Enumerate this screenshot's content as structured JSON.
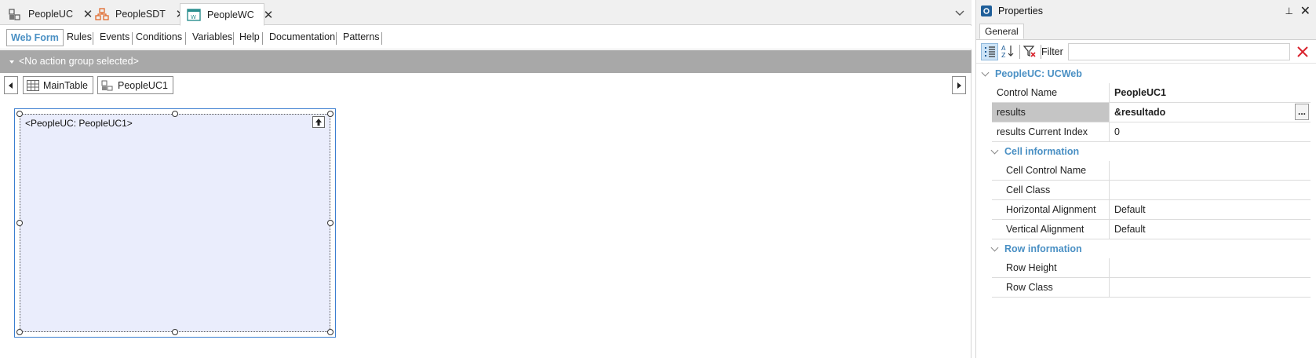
{
  "editor": {
    "doc_tabs": [
      {
        "label": "PeopleUC",
        "icon": "user-control-icon",
        "close": "✕"
      },
      {
        "label": "PeopleSDT",
        "icon": "sdt-icon",
        "close": "✕"
      },
      {
        "label": "PeopleWC",
        "icon": "web-component-icon",
        "close": "✕",
        "active": true
      }
    ],
    "section_tabs": [
      "Web Form",
      "Rules",
      "Events",
      "Conditions",
      "Variables",
      "Help",
      "Documentation",
      "Patterns"
    ],
    "active_section": "Web Form",
    "action_group": "<No action group selected>",
    "breadcrumb": [
      "MainTable",
      "PeopleUC1"
    ],
    "control_label": "<PeopleUC: PeopleUC1>"
  },
  "properties": {
    "title": "Properties",
    "pin": "⊥",
    "close": "✕",
    "tab": "General",
    "filter_label": "Filter",
    "filter_value": "",
    "category_main": "PeopleUC: UCWeb",
    "rows_main": [
      {
        "name": "Control Name",
        "value": "PeopleUC1",
        "bold": true
      },
      {
        "name": "results",
        "value": "&resultado",
        "bold": true,
        "ellipsis": "..."
      },
      {
        "name": "results Current Index",
        "value": "0"
      }
    ],
    "category_cell": "Cell information",
    "rows_cell": [
      {
        "name": "Cell Control Name",
        "value": ""
      },
      {
        "name": "Cell Class",
        "value": ""
      },
      {
        "name": "Horizontal Alignment",
        "value": "Default"
      },
      {
        "name": "Vertical Alignment",
        "value": "Default"
      }
    ],
    "category_row": "Row information",
    "rows_row": [
      {
        "name": "Row Height",
        "value": ""
      },
      {
        "name": "Row Class",
        "value": ""
      }
    ]
  },
  "colors": {
    "accent": "#4a90c4",
    "action_bar": "#a8a8a8",
    "control_fill": "#eaedfc",
    "selection_border": "#3c7fd0",
    "clear_filter": "#d9232d"
  }
}
